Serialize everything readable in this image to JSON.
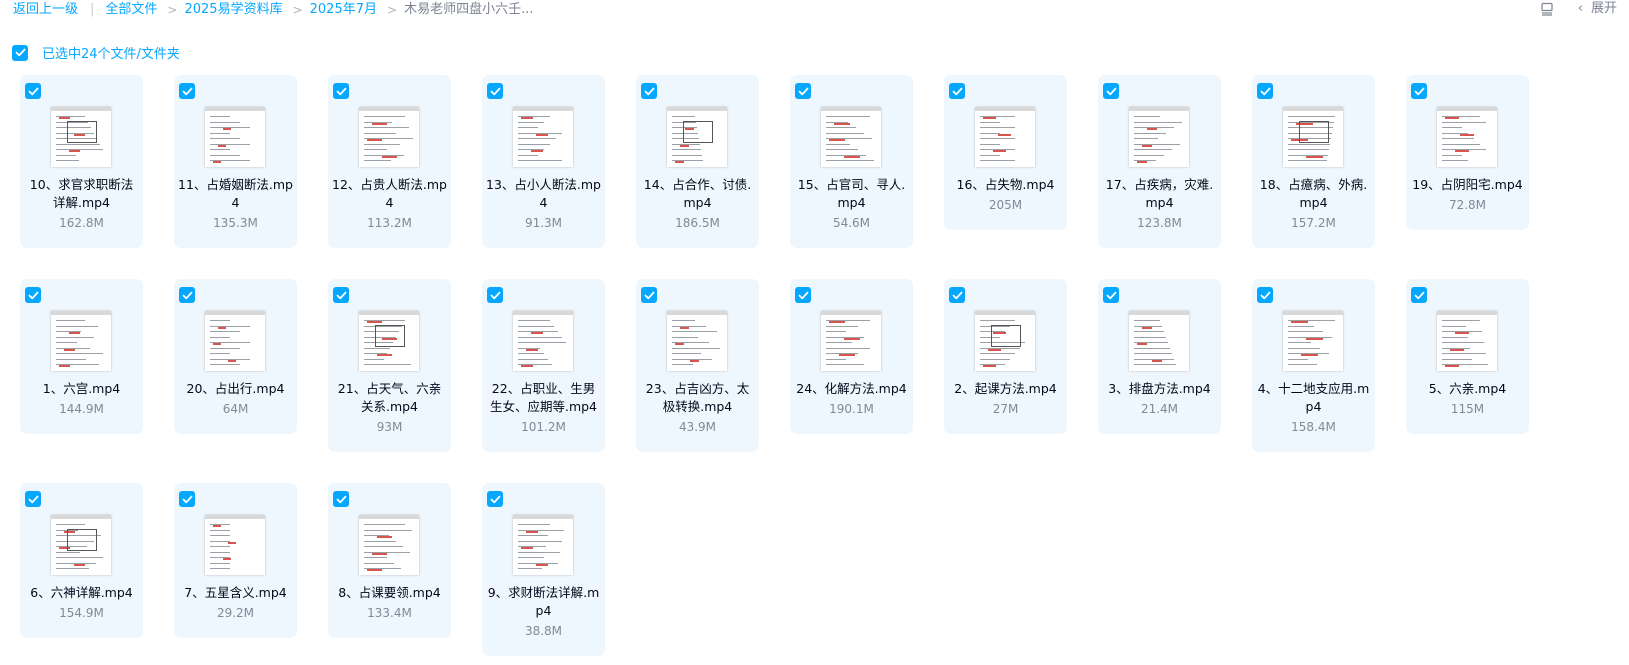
{
  "breadcrumb": {
    "back_label": "返回上一级",
    "items": [
      "全部文件",
      "2025易学资料库",
      "2025年7月"
    ],
    "current": "木易老师四盘小六壬..."
  },
  "toolbar": {
    "list_view_icon": "list-view-icon",
    "expand_label": "展开"
  },
  "selection": {
    "label": "已选中24个文件/文件夹"
  },
  "colors": {
    "accent": "#06a7ff",
    "card_bg": "#eef7fd",
    "text": "#03081a",
    "muted": "#818999"
  },
  "files": [
    {
      "name": "10、求官求职断法详解.mp4",
      "size": "162.8M",
      "checked": true
    },
    {
      "name": "11、占婚姻断法.mp4",
      "size": "135.3M",
      "checked": true
    },
    {
      "name": "12、占贵人断法.mp4",
      "size": "113.2M",
      "checked": true
    },
    {
      "name": "13、占小人断法.mp4",
      "size": "91.3M",
      "checked": true
    },
    {
      "name": "14、占合作、讨债.mp4",
      "size": "186.5M",
      "checked": true
    },
    {
      "name": "15、占官司、寻人.mp4",
      "size": "54.6M",
      "checked": true
    },
    {
      "name": "16、占失物.mp4",
      "size": "205M",
      "checked": true
    },
    {
      "name": "17、占疾病，灾难.mp4",
      "size": "123.8M",
      "checked": true
    },
    {
      "name": "18、占癔病、外病.mp4",
      "size": "157.2M",
      "checked": true
    },
    {
      "name": "19、占阴阳宅.mp4",
      "size": "72.8M",
      "checked": true
    },
    {
      "name": "1、六宫.mp4",
      "size": "144.9M",
      "checked": true
    },
    {
      "name": "20、占出行.mp4",
      "size": "64M",
      "checked": true
    },
    {
      "name": "21、占天气、六亲关系.mp4",
      "size": "93M",
      "checked": true
    },
    {
      "name": "22、占职业、生男生女、应期等.mp4",
      "size": "101.2M",
      "checked": true
    },
    {
      "name": "23、占吉凶方、太极转换.mp4",
      "size": "43.9M",
      "checked": true
    },
    {
      "name": "24、化解方法.mp4",
      "size": "190.1M",
      "checked": true
    },
    {
      "name": "2、起课方法.mp4",
      "size": "27M",
      "checked": true
    },
    {
      "name": "3、排盘方法.mp4",
      "size": "21.4M",
      "checked": true
    },
    {
      "name": "4、十二地支应用.mp4",
      "size": "158.4M",
      "checked": true
    },
    {
      "name": "5、六亲.mp4",
      "size": "115M",
      "checked": true
    },
    {
      "name": "6、六神详解.mp4",
      "size": "154.9M",
      "checked": true
    },
    {
      "name": "7、五星含义.mp4",
      "size": "29.2M",
      "checked": true
    },
    {
      "name": "8、占课要领.mp4",
      "size": "133.4M",
      "checked": true
    },
    {
      "name": "9、求财断法详解.mp4",
      "size": "38.8M",
      "checked": true
    }
  ]
}
